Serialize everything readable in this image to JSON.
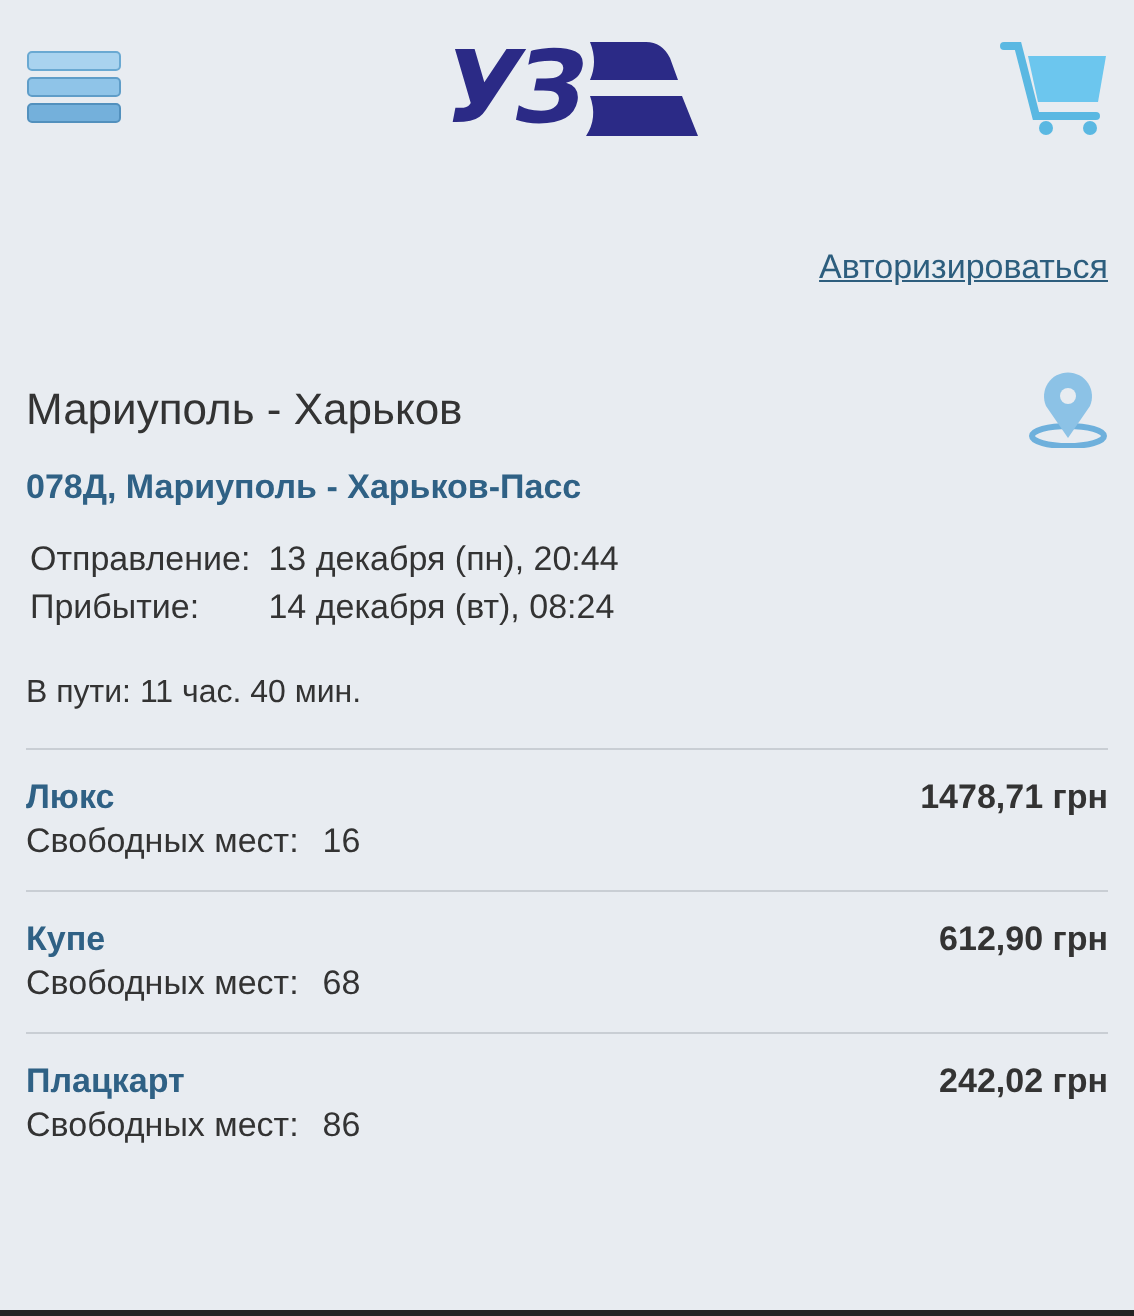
{
  "header": {
    "logo": "УЗ"
  },
  "login_link": "Авторизироваться",
  "trip": {
    "title": "Мариуполь - Харьков",
    "train": "078Д, Мариуполь - Харьков-Пасс",
    "schedule": [
      {
        "label": "Отправление:",
        "value": "13 декабря (пн), 20:44"
      },
      {
        "label": "Прибытие:",
        "value": "14 декабря (вт), 08:24"
      }
    ],
    "duration": "В пути: 11 час. 40 мин."
  },
  "classes": [
    {
      "name": "Люкс",
      "price": "1478,71 грн",
      "seats_label": "Свободных мест:",
      "seats": "16"
    },
    {
      "name": "Купе",
      "price": "612,90 грн",
      "seats_label": "Свободных мест:",
      "seats": "68"
    },
    {
      "name": "Плацкарт",
      "price": "242,02 грн",
      "seats_label": "Свободных мест:",
      "seats": "86"
    }
  ]
}
